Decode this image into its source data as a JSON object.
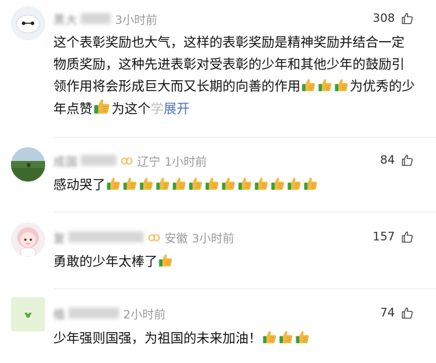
{
  "comments": [
    {
      "username": "黑大",
      "time": "3小时前",
      "location": "",
      "likes": "308",
      "text_parts": [
        "这个表彰奖励也大气，这样的表彰奖励是精神奖励并结合一定物质奖励，这种先进表彰对受表彰的少年和其他少年的鼓励引领作用将会形成巨大而又长期的向善的作用",
        "为优秀的少年点赞",
        "为这个",
        "学"
      ],
      "expand_label": "展开"
    },
    {
      "username": "成国",
      "time": "1小时前",
      "location": "辽宁",
      "likes": "84",
      "text": "感动哭了"
    },
    {
      "username": "复",
      "time": "3小时前",
      "location": "安徽",
      "likes": "157",
      "text": "勇敢的少年太棒了"
    },
    {
      "username": "植",
      "time": "2小时前",
      "location": "",
      "likes": "74",
      "text": "少年强则国强，为祖国的未来加油！"
    }
  ],
  "icons": {
    "like": "thumbs-up-outline-icon",
    "emoji": "thumbs-up-emoji-icon"
  },
  "colors": {
    "link": "#4a73b8",
    "meta": "#9a9a9a",
    "vip": "#f0b23a",
    "emoji_thumb": "#f5b83d",
    "emoji_cuff": "#3a9f3a"
  }
}
